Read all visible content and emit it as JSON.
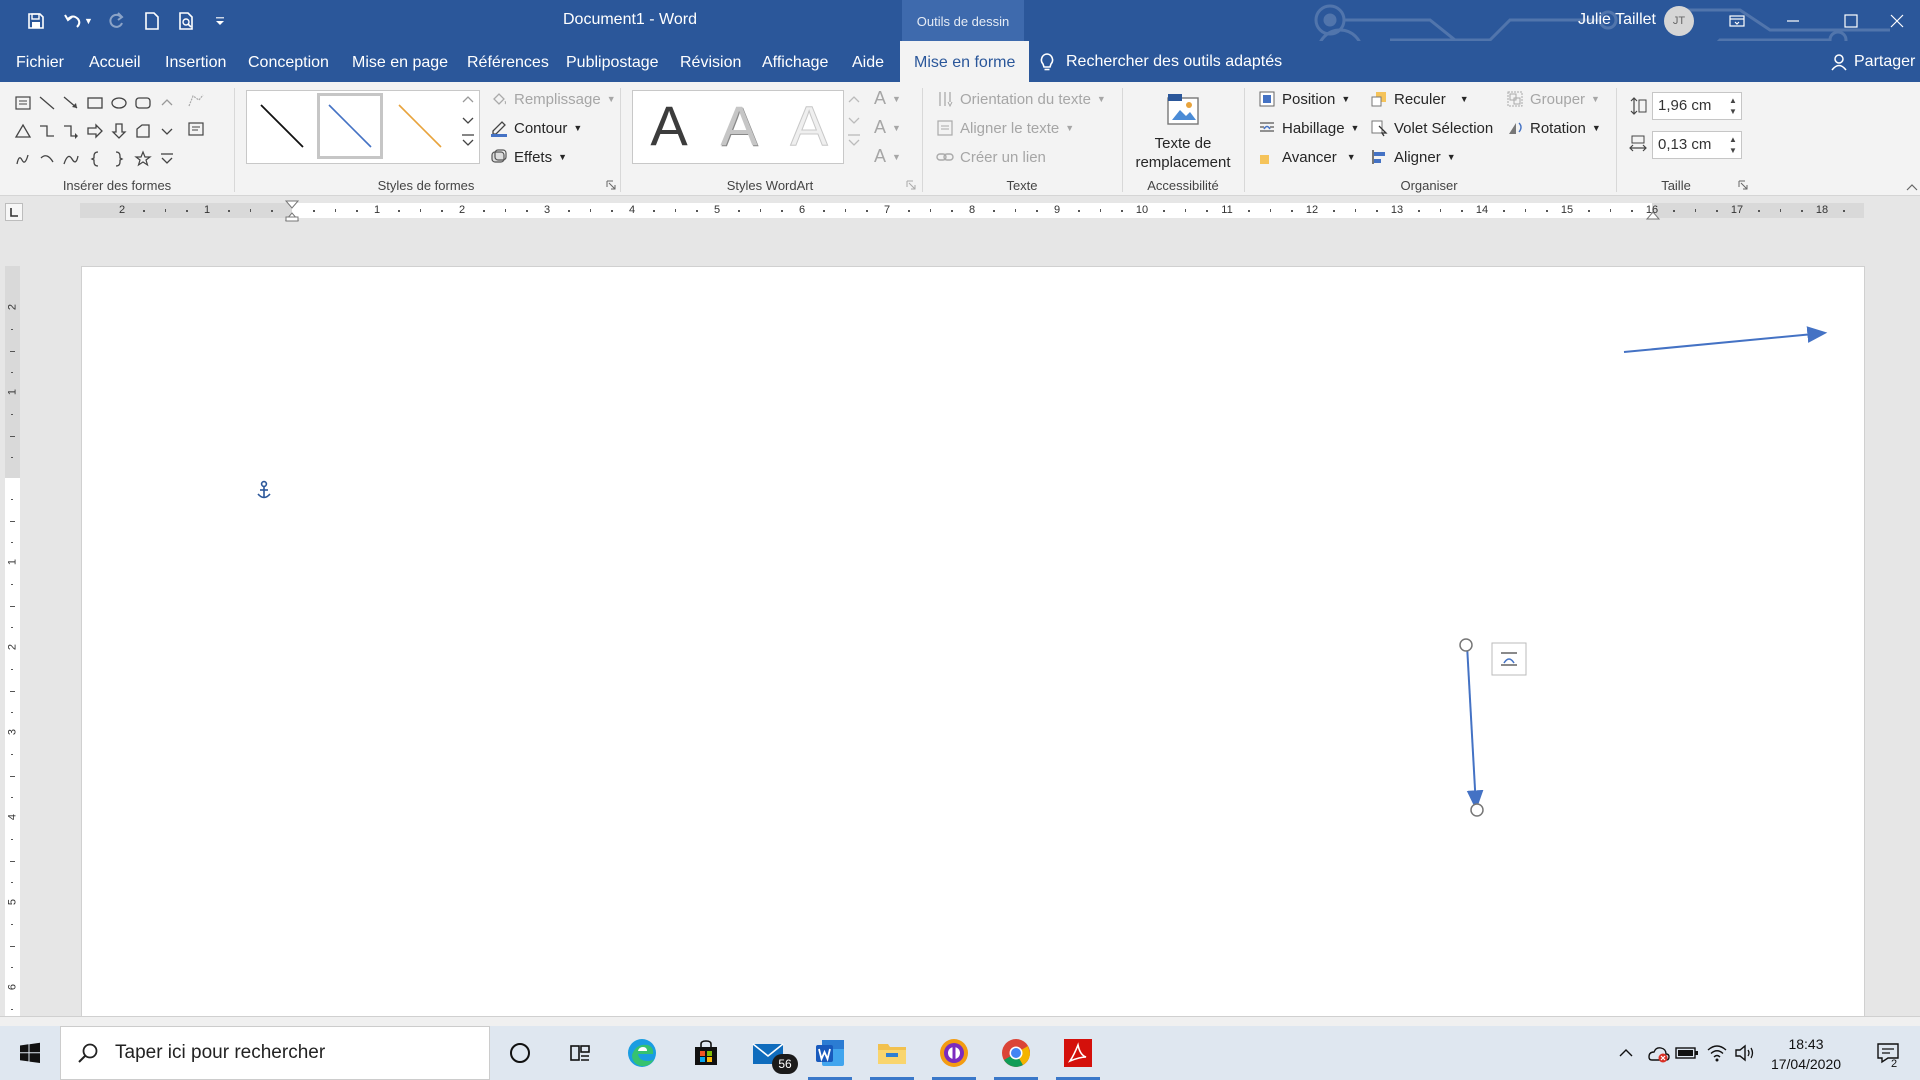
{
  "titlebar": {
    "title": "Document1  -  Word",
    "context_tab": "Outils de dessin",
    "user": "Julie Taillet",
    "initials": "JT"
  },
  "tabs": {
    "items": [
      {
        "label": "Fichier"
      },
      {
        "label": "Accueil"
      },
      {
        "label": "Insertion"
      },
      {
        "label": "Conception"
      },
      {
        "label": "Mise en page"
      },
      {
        "label": "Références"
      },
      {
        "label": "Publipostage"
      },
      {
        "label": "Révision"
      },
      {
        "label": "Affichage"
      },
      {
        "label": "Aide"
      },
      {
        "label": "Mise en forme"
      }
    ],
    "tell_me": "Rechercher des outils adaptés",
    "share": "Partager"
  },
  "ribbon": {
    "insert_shapes": {
      "label": "Insérer des formes"
    },
    "shape_styles": {
      "label": "Styles de formes",
      "fill": "Remplissage",
      "outline": "Contour",
      "effects": "Effets"
    },
    "wordart": {
      "label": "Styles WordArt",
      "letter": "A"
    },
    "text": {
      "label": "Texte",
      "direction": "Orientation du texte",
      "align": "Aligner le texte",
      "link": "Créer un lien"
    },
    "accessibility": {
      "label": "Accessibilité",
      "alt_text": "Texte de remplacement"
    },
    "arrange": {
      "label": "Organiser",
      "position": "Position",
      "wrap": "Habillage",
      "forward": "Avancer",
      "backward": "Reculer",
      "selection_pane": "Volet Sélection",
      "align": "Aligner",
      "group": "Grouper",
      "rotate": "Rotation"
    },
    "size": {
      "label": "Taille",
      "height": "1,96 cm",
      "width": "0,13 cm"
    }
  },
  "ruler": {
    "h_labels": [
      "2",
      "1",
      "1",
      "2",
      "3",
      "4",
      "5",
      "6",
      "7",
      "8",
      "9",
      "10",
      "11",
      "12",
      "13",
      "14",
      "15",
      "16",
      "17",
      "18"
    ],
    "v_labels": [
      "2",
      "1",
      "1",
      "2",
      "3",
      "4",
      "5",
      "6"
    ]
  },
  "taskbar": {
    "search_placeholder": "Taper ici pour rechercher",
    "mail_badge": "56",
    "time": "18:43",
    "date": "17/04/2020",
    "notifications": "2"
  },
  "colors": {
    "accent": "#2b579a",
    "arrow": "#4472c4",
    "shape_style_orange": "#e8a33c"
  }
}
